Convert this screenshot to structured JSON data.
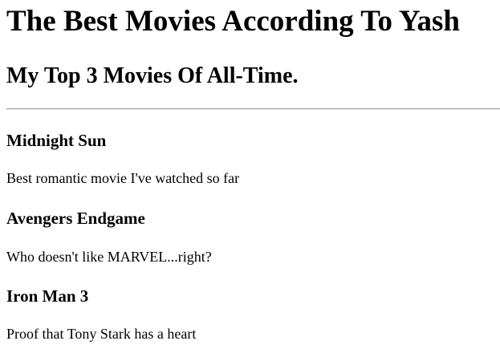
{
  "header": {
    "title": "The Best Movies According To Yash",
    "subtitle": "My Top 3 Movies Of All-Time."
  },
  "movies": [
    {
      "title": "Midnight Sun",
      "description": "Best romantic movie I've watched so far"
    },
    {
      "title": "Avengers Endgame",
      "description": "Who doesn't like MARVEL...right?"
    },
    {
      "title": "Iron Man 3",
      "description": "Proof that Tony Stark has a heart"
    }
  ]
}
